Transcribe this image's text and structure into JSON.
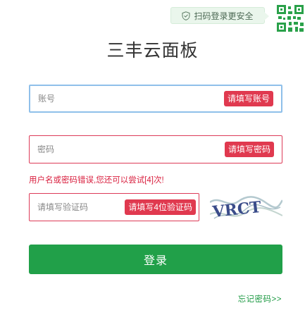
{
  "qr_hint": {
    "text": "扫码登录更安全",
    "icon": "shield-check-icon"
  },
  "qr_corner": {
    "icon": "qr-code-icon",
    "color": "#2aa14a"
  },
  "title": "三丰云面板",
  "account": {
    "placeholder": "账号",
    "tip": "请填写账号"
  },
  "password": {
    "placeholder": "密码",
    "tip": "请填写密码"
  },
  "error": "用户名或密码错误,您还可以尝试[4]次!",
  "captcha": {
    "placeholder": "请填写验证码",
    "tip": "请填写4位验证码",
    "image_text": "VRCT"
  },
  "login_button": "登录",
  "forgot_link": "忘记密码>>",
  "colors": {
    "accent": "#21a049",
    "error": "#dd3b58",
    "focus": "#8fc0ea",
    "hint_bg": "#eaf6ec"
  }
}
